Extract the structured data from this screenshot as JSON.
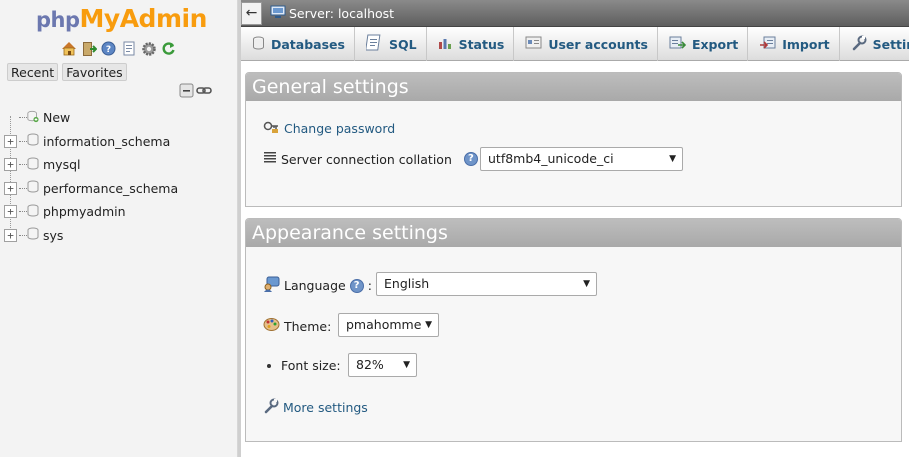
{
  "logo": {
    "php": "php",
    "my": "My",
    "admin": "Admin"
  },
  "sidebar": {
    "quick_icons": [
      "home-icon",
      "logout-icon",
      "help-icon",
      "docs-icon",
      "settings-icon",
      "reload-icon"
    ],
    "tabs": [
      "Recent",
      "Favorites"
    ],
    "tree_tools": [
      "collapse-all-icon",
      "link-icon"
    ],
    "new_label": "New",
    "databases": [
      "information_schema",
      "mysql",
      "performance_schema",
      "phpmyadmin",
      "sys"
    ],
    "expander_symbol": "+"
  },
  "topbar": {
    "back_symbol": "←",
    "server_label": "Server: localhost"
  },
  "menu": {
    "tabs": [
      {
        "label": "Databases",
        "icon": "database-icon"
      },
      {
        "label": "SQL",
        "icon": "sql-icon"
      },
      {
        "label": "Status",
        "icon": "status-icon"
      },
      {
        "label": "User accounts",
        "icon": "users-icon"
      },
      {
        "label": "Export",
        "icon": "export-icon"
      },
      {
        "label": "Import",
        "icon": "import-icon"
      },
      {
        "label": "Settings",
        "icon": "wrench-icon"
      }
    ]
  },
  "general": {
    "title": "General settings",
    "change_password": "Change password",
    "collation_label": "Server connection collation",
    "collation_suffix": ":",
    "collation_value": "utf8mb4_unicode_ci"
  },
  "appearance": {
    "title": "Appearance settings",
    "language_label": "Language",
    "language_suffix": ":",
    "language_value": "English",
    "theme_label": "Theme:",
    "theme_value": "pmahomme",
    "fontsize_label": "Font size:",
    "fontsize_value": "82%",
    "more_settings": "More settings"
  },
  "help_symbol": "?",
  "caret_symbol": "▼",
  "colors": {
    "link": "#235a81",
    "logo_php": "#6c78af",
    "logo_admin": "#f89c0e"
  }
}
